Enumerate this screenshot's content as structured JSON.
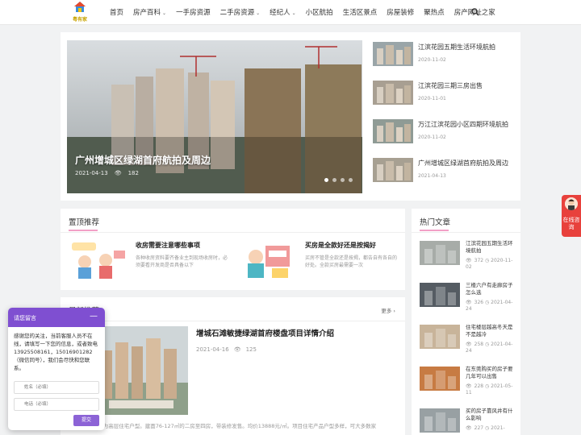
{
  "header": {
    "logo_text": "粤有家",
    "nav": [
      {
        "label": "首页",
        "dropdown": false
      },
      {
        "label": "房产百科",
        "dropdown": true
      },
      {
        "label": "一手房资源",
        "dropdown": false
      },
      {
        "label": "二手房资源",
        "dropdown": true
      },
      {
        "label": "经纪人",
        "dropdown": true
      },
      {
        "label": "小区航拍",
        "dropdown": false
      },
      {
        "label": "生活区景点",
        "dropdown": false
      },
      {
        "label": "房屋装修",
        "dropdown": false
      },
      {
        "label": "聚热点",
        "dropdown": false
      },
      {
        "label": "房产网址之家",
        "dropdown": false
      }
    ]
  },
  "hero": {
    "title": "广州增城区绿湖首府航拍及周边",
    "date": "2021-04-13",
    "views": "182",
    "slides_count": 4,
    "active_slide": 1
  },
  "side_news": [
    {
      "title": "江滨花园五期生活环境航拍",
      "date": "2020-11-02"
    },
    {
      "title": "江滨花园三期三房出售",
      "date": "2020-11-01"
    },
    {
      "title": "万江江滨花园小区四期环境航拍",
      "date": "2020-11-02"
    },
    {
      "title": "广州增城区绿湖首府航拍及周边",
      "date": "2021-04-13"
    }
  ],
  "pinned": {
    "heading": "置顶推荐",
    "items": [
      {
        "title": "收房需要注意哪些事项",
        "desc": "各种收房资料要齐备业主到现场收房时，必须要看开发商是否具备以下"
      },
      {
        "title": "买房是全款好还是按揭好",
        "desc": "买房不管是全款还是按揭，都告自有各自的好处。全款买房最需要一次"
      }
    ]
  },
  "latest": {
    "heading": "最新推荐",
    "more": "更多 ›",
    "title": "增城石滩敏捷绿湖首府楼盘项目详情介绍",
    "date": "2021-04-16",
    "views": "125",
    "desc": "...售为高层住宅户型。建面76-127㎡的二房至四房，带装修发售。均价13888元/㎡。项目住宅产品户型多样，可大多数家"
  },
  "hot": {
    "heading": "热门文章",
    "items": [
      {
        "title": "江滨花园五期生活环境航拍",
        "views": "372",
        "date": "2020-11-02"
      },
      {
        "title": "三楼六户有走廊房子怎么选",
        "views": "326",
        "date": "2021-04-24"
      },
      {
        "title": "住宅楼层越高冬天是不是越冷",
        "views": "258",
        "date": "2021-04-24"
      },
      {
        "title": "在东莞购买的房子要几年可以出售",
        "views": "228",
        "date": "2021-05-11"
      },
      {
        "title": "买的房子靠风井有什么影响",
        "views": "227",
        "date": "2021-"
      }
    ]
  },
  "chat": {
    "title": "请您留言",
    "minimize": "—",
    "message": "感谢您的关注，当前客服人员不在线，请填写一下您的信息，或者致电13925508161，15016901282（微信同号），我们会尽快和您联系。",
    "name_placeholder": "姓名（必填）",
    "phone_placeholder": "电话（必填）",
    "submit": "提交"
  },
  "float_tab": {
    "label": "在线咨询"
  },
  "colors": {
    "accent": "#7f4fd1",
    "float_tab": "#e8413c",
    "underline": "#f2a0c6"
  }
}
